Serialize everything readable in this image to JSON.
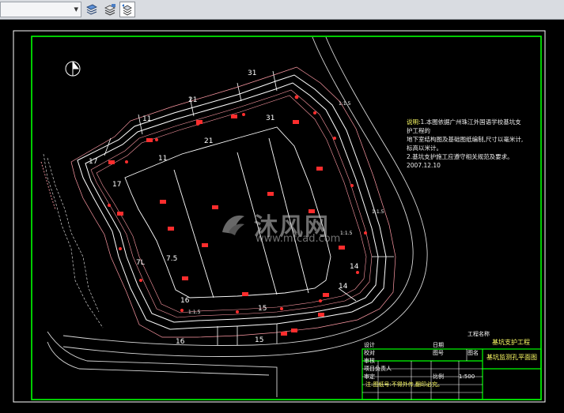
{
  "toolbar": {
    "dropdown_value": "",
    "buttons": [
      {
        "name": "layer-properties-icon"
      },
      {
        "name": "layer-state-icon"
      },
      {
        "name": "layer-previous-icon"
      }
    ]
  },
  "drawing": {
    "notes": {
      "label": "说明:",
      "line1": "1.本图依据广州珠江外国语学校基坑支护工程的",
      "line2": "地下室结构图及基础图纸编制,尺寸以毫米计,",
      "line3": "标高以米计。",
      "line4": "2.基坑支护施工应遵守相关规范及要求。",
      "line5": "2007.12.10"
    },
    "section_labels": [
      "11",
      "21",
      "31",
      "17",
      "17",
      "16",
      "16",
      "15",
      "15",
      "14",
      "14",
      "11",
      "21",
      "31",
      "7.5",
      "7L"
    ],
    "dims": [
      "1:1.5",
      "1:1.5",
      "1:1.5",
      "1:1.5"
    ],
    "watermark": {
      "text": "沐风网",
      "url": "www.mfcad.com"
    }
  },
  "title_block": {
    "project_label": "工程名称",
    "project_name": "基坑支护工程",
    "drawing_label": "图名",
    "drawing_name": "基坑监测孔平面图",
    "row_labels": [
      "设计",
      "校对",
      "审核",
      "项目负责人",
      "审定"
    ],
    "date_label": "日期",
    "drawing_no_label": "图号",
    "scale_label": "比例",
    "scale_value": "1:500",
    "footer": "注:图纸号:不得外传,翻印必究。"
  },
  "colors": {
    "frame": "#00ff00",
    "outline": "#ffffff",
    "dim_lines": "#ff9aa5",
    "markers": "#ff2d2d",
    "title_text": "#ffff66"
  }
}
